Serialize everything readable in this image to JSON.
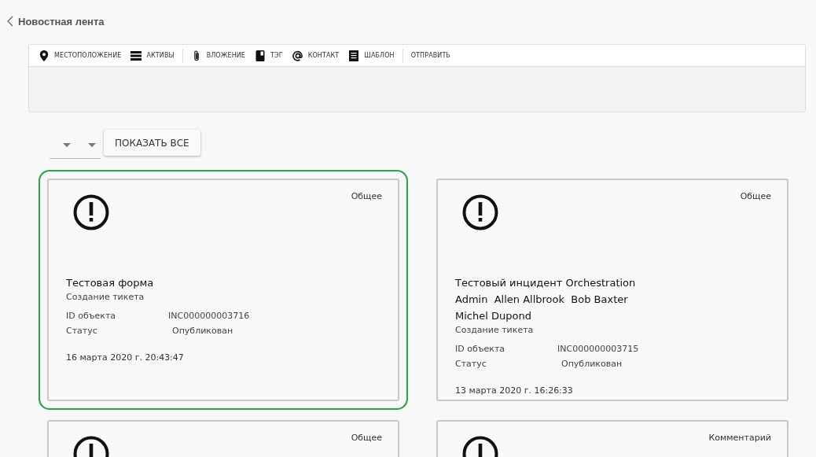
{
  "header": {
    "title": "Новостная лента"
  },
  "composer": {
    "toolbar_groups": [
      [
        {
          "label": "МЕСТОПОЛОЖЕНИЕ"
        },
        {
          "label": "АКТИВЫ"
        }
      ],
      [
        {
          "label": "ВЛОЖЕНИЕ"
        },
        {
          "label": "ТЭГ"
        },
        {
          "label": "КОНТАКТ"
        },
        {
          "label": "ШАБЛОН"
        }
      ],
      [
        {
          "label": "ОТПРАВИТЬ"
        }
      ]
    ]
  },
  "filters": {
    "show_all_button": "ПОКАЗАТЬ ВСЕ"
  },
  "cards": [
    {
      "selected": true,
      "category": "Общее",
      "title": "Тестовая форма",
      "subtitle": "Создание тикета",
      "fields": [
        {
          "label": "ID объекта",
          "value": "INC000000003716"
        },
        {
          "label": "Статус",
          "value": "Опубликован"
        }
      ],
      "date": "16 марта 2020 г. 20:43:47"
    },
    {
      "selected": false,
      "category": "Общее",
      "title": "Тестовый инцидент Orchestration Admin  Allen Allbrook  Bob Baxter  Michel Dupond",
      "subtitle": "Создание тикета",
      "fields": [
        {
          "label": "ID объекта",
          "value": "INC000000003715"
        },
        {
          "label": "Статус",
          "value": "Опубликован"
        }
      ],
      "date": "13 марта 2020 г. 16:26:33"
    },
    {
      "selected": false,
      "category": "Общее"
    },
    {
      "selected": false,
      "category": "Комментарий"
    }
  ]
}
